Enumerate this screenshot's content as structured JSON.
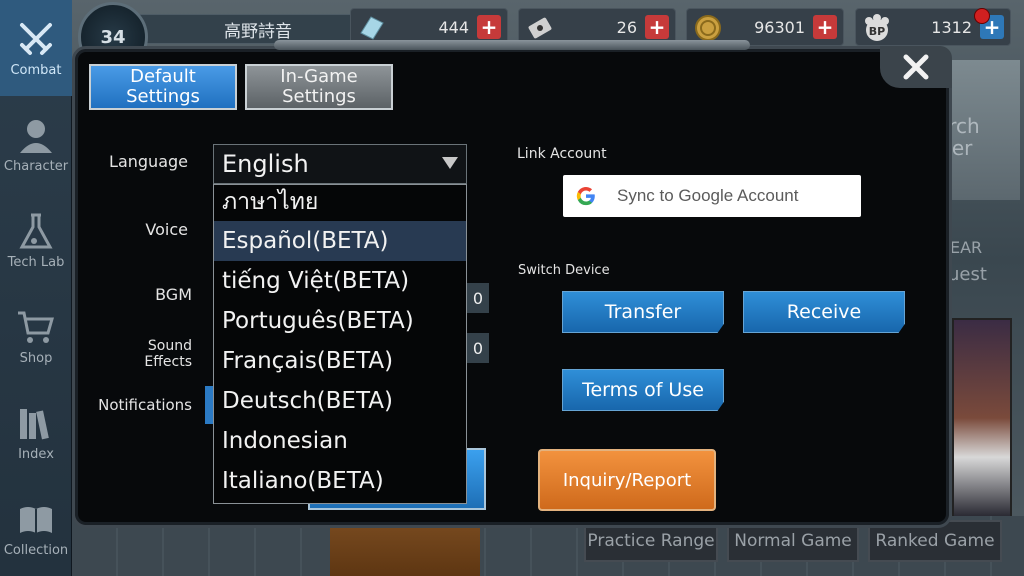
{
  "player": {
    "level": "34",
    "name": "高野詩音"
  },
  "resources": [
    {
      "icon": "crystal-icon",
      "value": "444"
    },
    {
      "icon": "ticket-icon",
      "value": "26"
    },
    {
      "icon": "coin-icon",
      "value": "96301"
    },
    {
      "icon": "bp-icon",
      "value": "1312"
    }
  ],
  "sidebar": {
    "items": [
      {
        "label": "Combat",
        "icon": "crossed-swords-icon",
        "active": true
      },
      {
        "label": "Character",
        "icon": "character-bust-icon"
      },
      {
        "label": "Tech Lab",
        "icon": "flask-icon"
      },
      {
        "label": "Shop",
        "icon": "cart-icon"
      },
      {
        "label": "Index",
        "icon": "books-icon"
      },
      {
        "label": "Collection",
        "icon": "open-book-icon"
      }
    ]
  },
  "background": {
    "research_center_a": "arch",
    "research_center_b": "ter",
    "quest_a": "EAR",
    "quest_b": "uest",
    "bottom_buttons": [
      "Practice Range",
      "Normal Game",
      "Ranked Game"
    ]
  },
  "dialog": {
    "tabs": {
      "default_line1": "Default",
      "default_line2": "Settings",
      "ingame_line1": "In-Game",
      "ingame_line2": "Settings"
    },
    "labels": {
      "language": "Language",
      "voice": "Voice",
      "bgm": "BGM",
      "sound_effects": "Sound Effects",
      "notifications": "Notifications"
    },
    "language": {
      "selected": "English",
      "options": [
        "ภาษาไทย",
        "Español(BETA)",
        "tiếng Việt(BETA)",
        "Português(BETA)",
        "Français(BETA)",
        "Deutsch(BETA)",
        "Indonesian",
        "Italiano(BETA)"
      ],
      "highlighted_index": 1
    },
    "bgm_value": "0",
    "sfx_value": "0",
    "link_account": {
      "label": "Link Account",
      "google_button": "Sync to Google Account"
    },
    "switch_device": {
      "label": "Switch Device",
      "transfer": "Transfer",
      "receive": "Receive"
    },
    "terms_button": "Terms of Use",
    "inquiry_button": "Inquiry/Report"
  },
  "colors": {
    "accent_blue": "#2070c0",
    "orange": "#cf6a1c",
    "dialog_bg": "#07090b",
    "sidebar_active": "#2f5a7e"
  }
}
